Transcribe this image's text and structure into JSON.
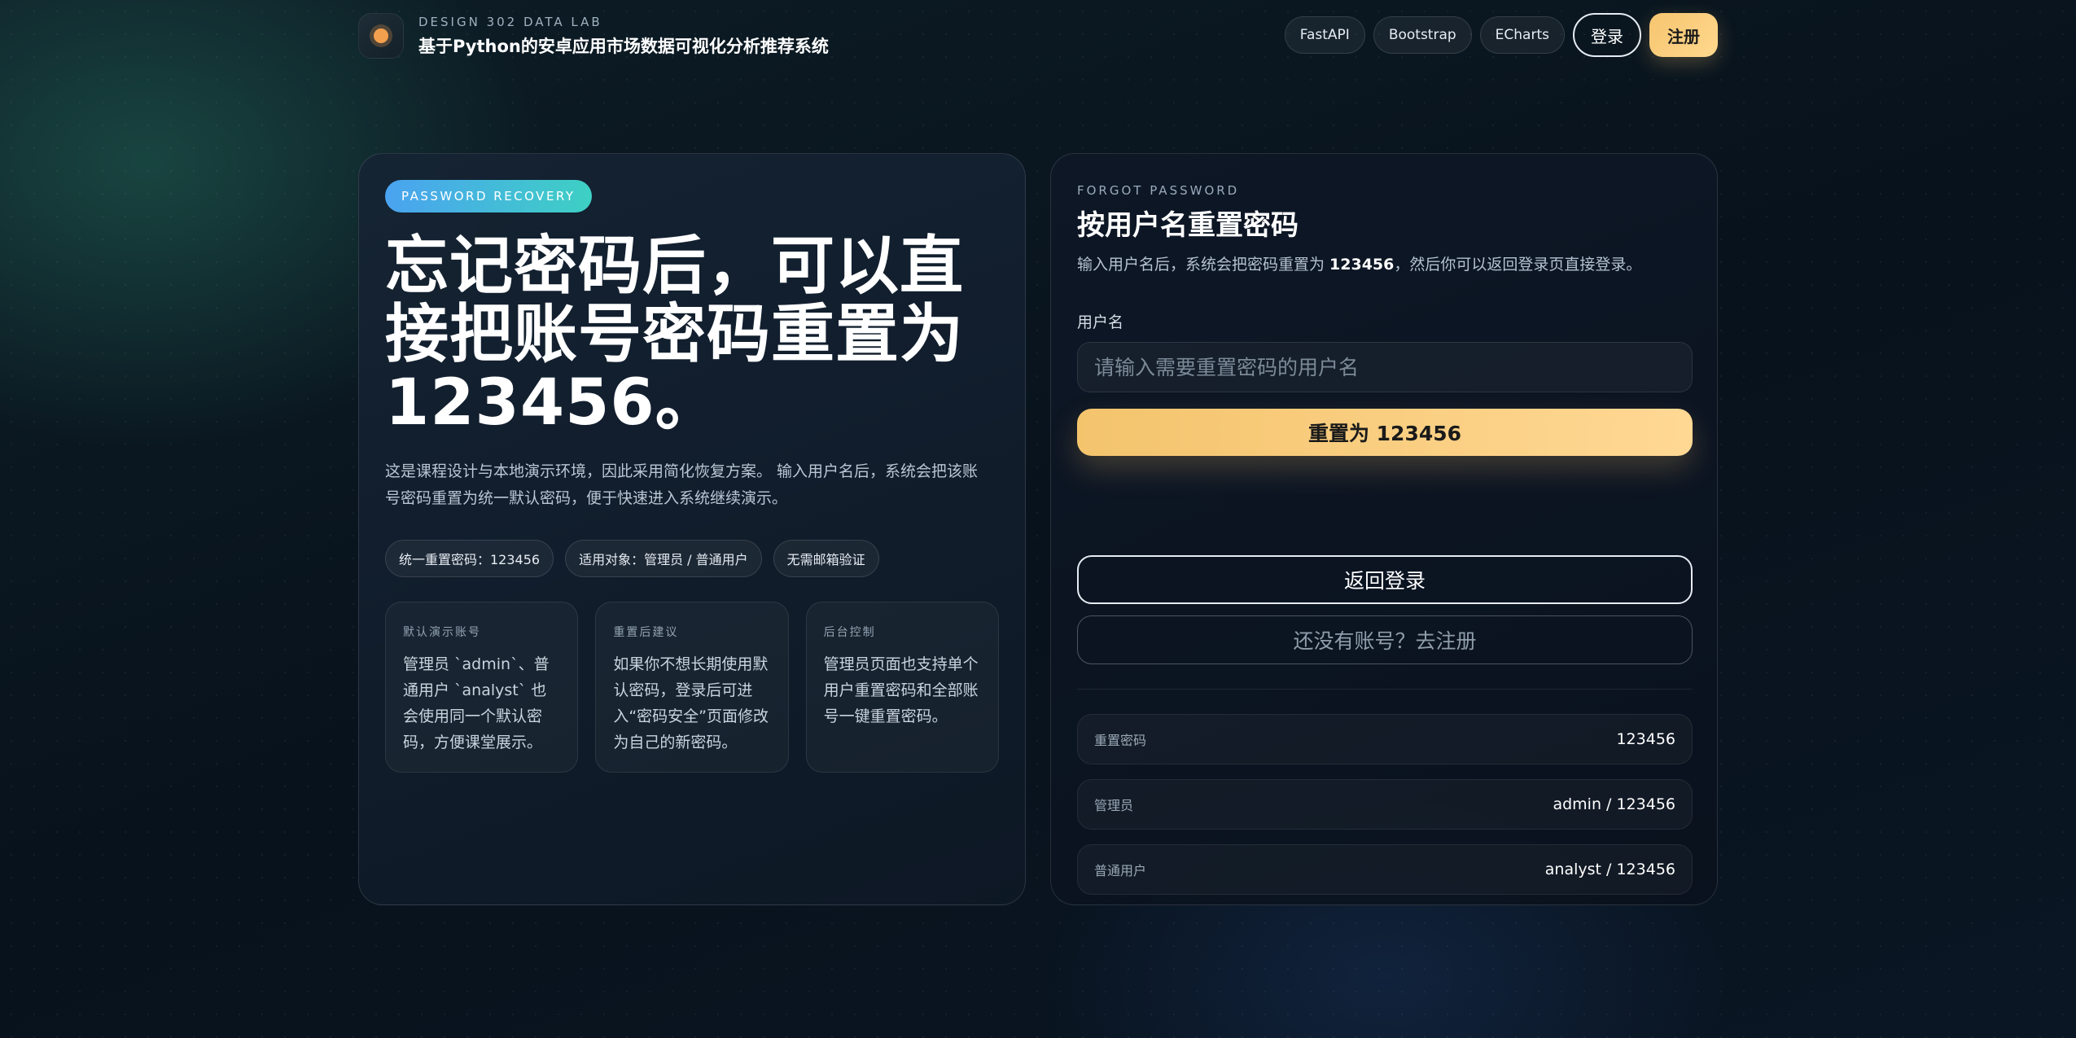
{
  "header": {
    "kicker": "DESIGN 302 DATA LAB",
    "title": "基于Python的安卓应用市场数据可视化分析推荐系统",
    "nav_chips": [
      "FastAPI",
      "Bootstrap",
      "ECharts"
    ],
    "login_label": "登录",
    "register_label": "注册"
  },
  "left": {
    "badge": "PASSWORD RECOVERY",
    "hero_title": "忘记密码后，可以直接把账号密码重置为 123456。",
    "description": "这是课程设计与本地演示环境，因此采用简化恢复方案。 输入用户名后，系统会把该账号密码重置为统一默认密码，便于快速进入系统继续演示。",
    "tags": [
      "统一重置密码：123456",
      "适用对象：管理员 / 普通用户",
      "无需邮箱验证"
    ],
    "info_cards": [
      {
        "kicker": "默认演示账号",
        "body": "管理员 `admin`、普通用户 `analyst` 也会使用同一个默认密码，方便课堂展示。"
      },
      {
        "kicker": "重置后建议",
        "body": "如果你不想长期使用默认密码，登录后可进入“密码安全”页面修改为自己的新密码。"
      },
      {
        "kicker": "后台控制",
        "body": "管理员页面也支持单个用户重置密码和全部账号一键重置密码。"
      }
    ]
  },
  "right": {
    "kicker": "FORGOT PASSWORD",
    "title": "按用户名重置密码",
    "desc_prefix": "输入用户名后，系统会把密码重置为 ",
    "desc_value": "123456",
    "desc_suffix": "，然后你可以返回登录页直接登录。",
    "username_label": "用户名",
    "username_placeholder": "请输入需要重置密码的用户名",
    "username_value": "",
    "reset_button": "重置为 123456",
    "back_button": "返回登录",
    "signup_button": "还没有账号？去注册",
    "info_rows": [
      {
        "label": "重置密码",
        "value": "123456"
      },
      {
        "label": "管理员",
        "value": "admin / 123456"
      },
      {
        "label": "普通用户",
        "value": "analyst / 123456"
      }
    ]
  },
  "colors": {
    "accent_gold": "#f6c56f",
    "badge_gradient_start": "#4aa3f0",
    "badge_gradient_end": "#3ed0c4",
    "logo_dot": "#f3a04e"
  },
  "icons": {
    "brand_logo": "orange-dot-logo"
  }
}
